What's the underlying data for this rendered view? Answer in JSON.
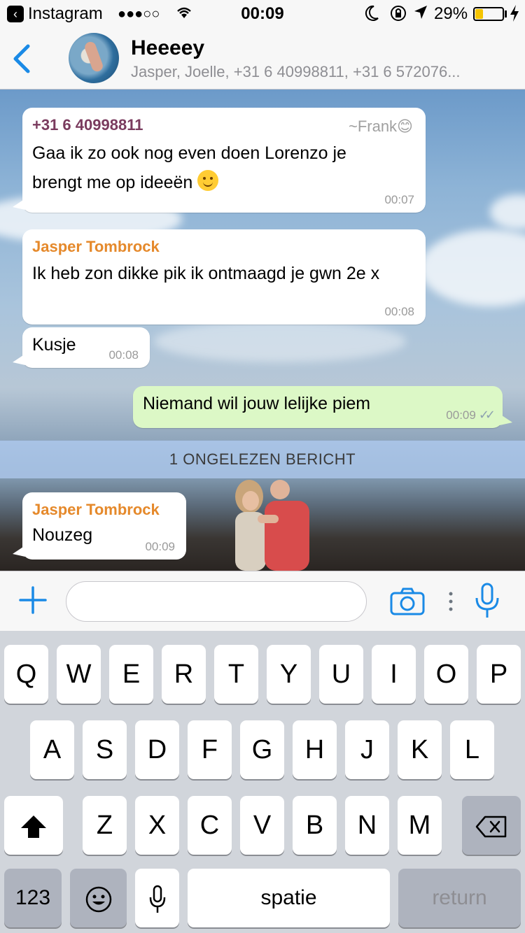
{
  "status_bar": {
    "back_app": "Instagram",
    "signal": "●●●○○",
    "time": "00:09",
    "battery_pct": "29%",
    "battery_level": 0.29
  },
  "header": {
    "title": "Heeeey",
    "members": "Jasper, Joelle, +31 6 40998811, +31 6 572076..."
  },
  "messages": [
    {
      "sender": "+31 6 40998811",
      "sender_color": "#7a3b5e",
      "alias": "~Frank😊",
      "text_line1": "Gaa ik zo ook nog even doen Lorenzo je",
      "text_line2": "brengt me op ideeën",
      "time": "00:07"
    },
    {
      "sender": "Jasper Tombrock",
      "sender_color": "#e5892b",
      "text": "Ik heb zon dikke pik ik ontmaagd je gwn 2e x",
      "time": "00:08"
    },
    {
      "text": "Kusje",
      "time": "00:08"
    },
    {
      "text": "Niemand wil jouw lelijke piem",
      "time": "00:09",
      "outgoing": true
    },
    {
      "sender": "Jasper Tombrock",
      "sender_color": "#e5892b",
      "text": "Nouzeg",
      "time": "00:09"
    }
  ],
  "unread_banner": "1 ONGELEZEN BERICHT",
  "input": {
    "placeholder": ""
  },
  "keyboard": {
    "row1": [
      "Q",
      "W",
      "E",
      "R",
      "T",
      "Y",
      "U",
      "I",
      "O",
      "P"
    ],
    "row2": [
      "A",
      "S",
      "D",
      "F",
      "G",
      "H",
      "J",
      "K",
      "L"
    ],
    "row3": [
      "Z",
      "X",
      "C",
      "V",
      "B",
      "N",
      "M"
    ],
    "numbers_key": "123",
    "space_key": "spatie",
    "return_key": "return"
  },
  "colors": {
    "accent": "#1a8ae6",
    "outgoing_bubble": "#dcf8c6",
    "unread_banner": "#aac6e8"
  }
}
